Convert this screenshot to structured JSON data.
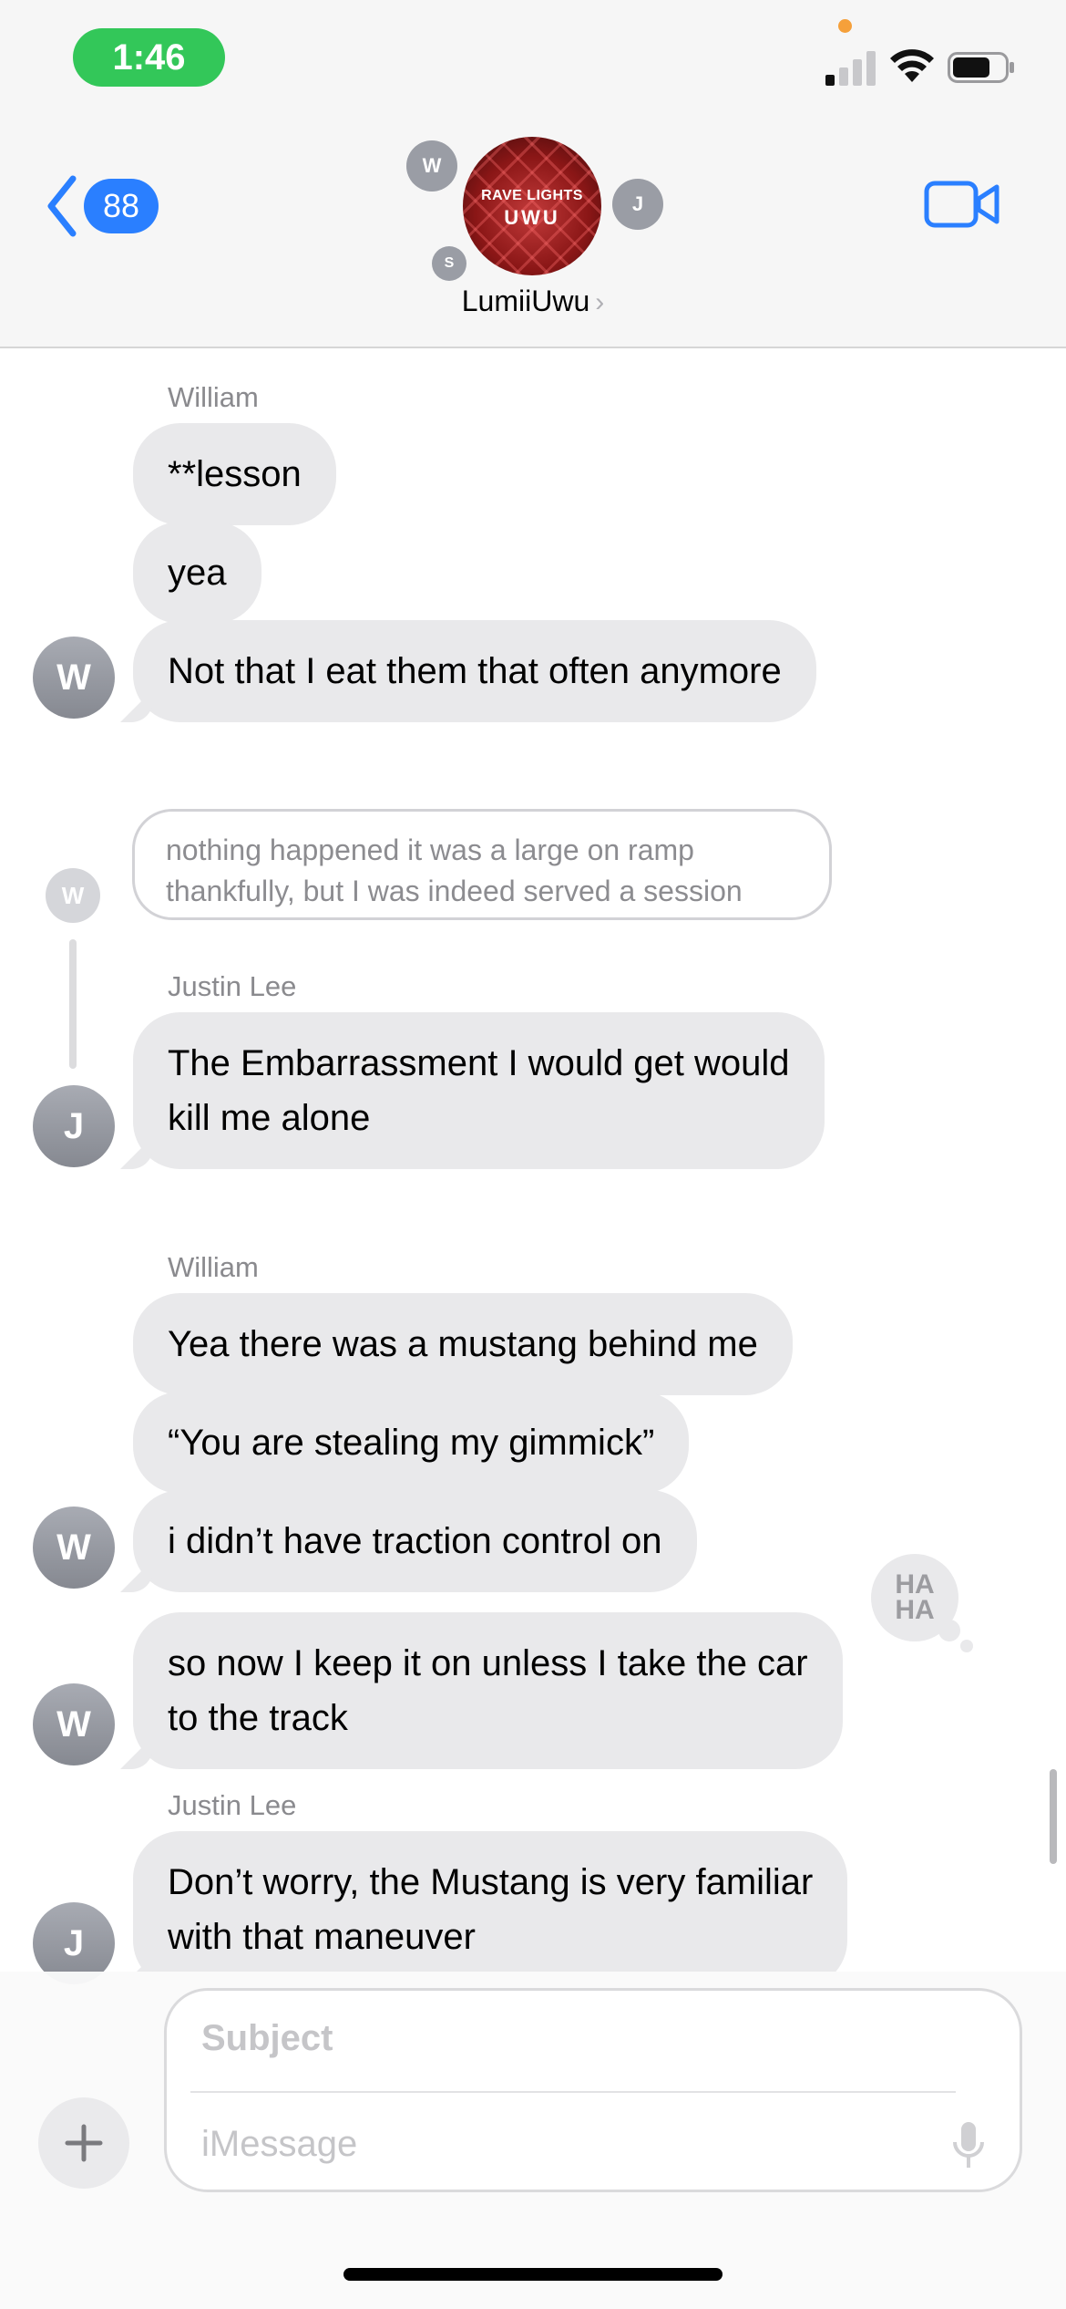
{
  "status_bar": {
    "time": "1:46"
  },
  "header": {
    "back_count": "88",
    "group_name": "LumiiUwu",
    "group_avatar_line1": "RAVE LIGHTS",
    "group_avatar_line2": "UWU",
    "member_initials": [
      "W",
      "J",
      "S"
    ]
  },
  "messages": {
    "block1": {
      "sender": "William",
      "bubbles": [
        "**lesson",
        "yea",
        "Not that I eat them that often anymore"
      ],
      "avatar": "W"
    },
    "reply": {
      "quoted": "nothing happened it was a large on ramp thankfully, but I was indeed served a session",
      "quoted_avatar": "W",
      "sender": "Justin Lee",
      "text_line1": "The Embarrassment I would get would",
      "text_line2": "kill me alone",
      "avatar": "J"
    },
    "block2": {
      "sender": "William",
      "bubbles": [
        "Yea there was a mustang behind me",
        "“You are stealing my gimmick”",
        "i didn’t have traction control on"
      ],
      "avatar": "W"
    },
    "block3": {
      "text_line1": "so now I keep it on unless I take the car",
      "text_line2": "to the track",
      "avatar": "W",
      "reaction": "HA HA"
    },
    "block4": {
      "sender": "Justin Lee",
      "text_line1": "Don’t worry, the Mustang is very familiar",
      "text_line2": "with that maneuver",
      "avatar": "J"
    }
  },
  "composer": {
    "subject_placeholder": "Subject",
    "message_placeholder": "iMessage"
  },
  "colors": {
    "accent": "#2a7fff",
    "time_pill": "#33c759",
    "bubble_gray": "#e9e9eb"
  },
  "icons": [
    "signal-icon",
    "wifi-icon",
    "battery-icon",
    "back-chevron-icon",
    "video-camera-icon",
    "plus-icon",
    "microphone-icon"
  ]
}
